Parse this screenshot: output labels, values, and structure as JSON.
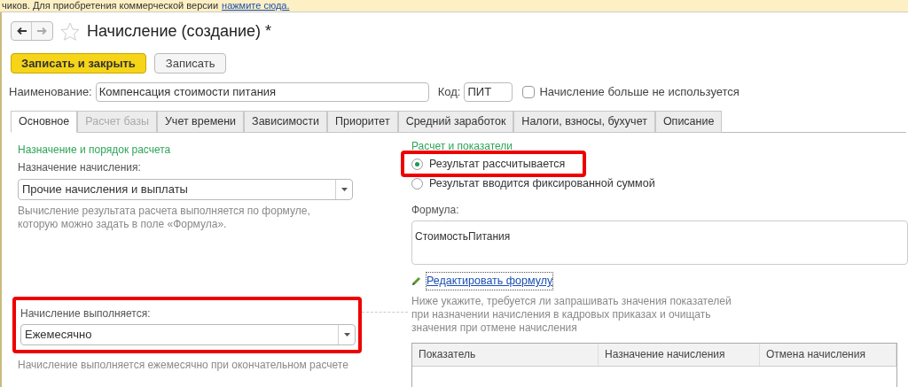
{
  "banner": {
    "text": "чиков. Для приобретения коммерческой версии",
    "link": "нажмите сюда."
  },
  "window": {
    "title": "Начисление (создание) *"
  },
  "buttons": [
    {
      "label": "Записать и закрыть",
      "kind": "primary"
    },
    {
      "label": "Записать",
      "kind": "normal"
    }
  ],
  "name_field": {
    "label": "Наименование:",
    "value": "Компенсация стоимости питания"
  },
  "code_field": {
    "label": "Код:",
    "value": "ПИТ"
  },
  "not_used": {
    "label": "Начисление больше не используется",
    "checked": false
  },
  "tabs": [
    {
      "label": "Основное",
      "selected": true,
      "disabled": false
    },
    {
      "label": "Расчет базы",
      "selected": false,
      "disabled": true
    },
    {
      "label": "Учет времени",
      "selected": false,
      "disabled": false
    },
    {
      "label": "Зависимости",
      "selected": false,
      "disabled": false
    },
    {
      "label": "Приоритет",
      "selected": false,
      "disabled": false
    },
    {
      "label": "Средний заработок",
      "selected": false,
      "disabled": false
    },
    {
      "label": "Налоги, взносы, бухучет",
      "selected": false,
      "disabled": false
    },
    {
      "label": "Описание",
      "selected": false,
      "disabled": false
    }
  ],
  "left": {
    "section_title": "Назначение и порядок расчета",
    "purpose": {
      "label": "Назначение начисления:",
      "value": "Прочие начисления и выплаты"
    },
    "purpose_note": "Вычисление результата расчета выполняется по формуле, которую можно задать в поле «Формула».",
    "schedule": {
      "label": "Начисление выполняется:",
      "value": "Ежемесячно",
      "highlighted": true
    },
    "schedule_note": "Начисление выполняется ежемесячно при окончательном расчете"
  },
  "right": {
    "section_title": "Расчет и показатели",
    "options": [
      {
        "label": "Результат рассчитывается",
        "selected": true,
        "highlighted": true
      },
      {
        "label": "Результат вводится фиксированной суммой",
        "selected": false,
        "highlighted": false
      }
    ],
    "formula": {
      "label": "Формула:",
      "value": "СтоимостьПитания"
    },
    "edit_link": "Редактировать формулу",
    "note": "Ниже укажите, требуется ли запрашивать значения показателей при назначении начисления в кадровых приказах и очищать значения при отмене начисления",
    "table": {
      "columns": [
        "Показатель",
        "Назначение начисления",
        "Отмена начисления"
      ]
    }
  }
}
